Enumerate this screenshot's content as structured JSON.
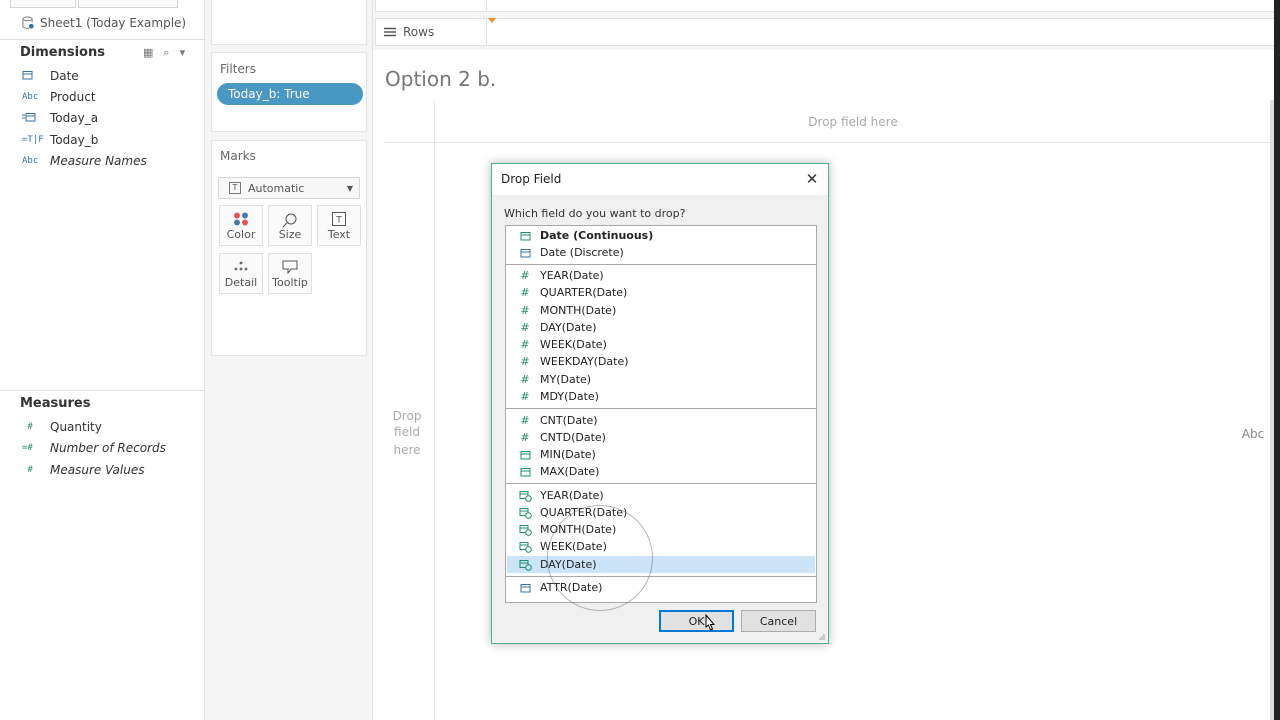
{
  "data_pane": {
    "datasource": "Sheet1 (Today Example)",
    "dimensions_header": "Dimensions",
    "dimensions": [
      {
        "icon": "calendar-icon",
        "type": "date",
        "label": "Date",
        "italic": false
      },
      {
        "icon": "abc-icon",
        "type": "string",
        "label": "Product",
        "italic": false
      },
      {
        "icon": "calculated-date-icon",
        "type": "calc-date",
        "label": "Today_a",
        "italic": false
      },
      {
        "icon": "boolean-icon",
        "type": "bool",
        "label": "Today_b",
        "italic": false
      },
      {
        "icon": "abc-icon",
        "type": "string",
        "label": "Measure Names",
        "italic": true
      }
    ],
    "measures_header": "Measures",
    "measures": [
      {
        "icon": "hash-icon",
        "label": "Quantity",
        "italic": false
      },
      {
        "icon": "calculated-hash-icon",
        "label": "Number of Records",
        "italic": true
      },
      {
        "icon": "hash-icon",
        "label": "Measure Values",
        "italic": true
      }
    ]
  },
  "cards": {
    "filters_title": "Filters",
    "filter_pill": "Today_b: True",
    "marks_title": "Marks",
    "marks_type": "Automatic",
    "mark_buttons": [
      "Color",
      "Size",
      "Text",
      "Detail",
      "Tooltip"
    ]
  },
  "shelves": {
    "rows_label": "Rows"
  },
  "view": {
    "title": "Option 2 b.",
    "drop_columns": "Drop field here",
    "drop_rows_1": "Drop",
    "drop_rows_2": "field",
    "drop_rows_3": "here",
    "abc": "Abc"
  },
  "dialog": {
    "title": "Drop Field",
    "question": "Which field do you want to drop?",
    "groups": [
      [
        {
          "label": "Date (Continuous)",
          "icon": "calendar-icon",
          "bold": true
        },
        {
          "label": "Date (Discrete)",
          "icon": "calendar-icon",
          "bold": false
        }
      ],
      [
        {
          "label": "YEAR(Date)",
          "icon": "hash-icon",
          "bold": false
        },
        {
          "label": "QUARTER(Date)",
          "icon": "hash-icon",
          "bold": false
        },
        {
          "label": "MONTH(Date)",
          "icon": "hash-icon",
          "bold": false
        },
        {
          "label": "DAY(Date)",
          "icon": "hash-icon",
          "bold": false
        },
        {
          "label": "WEEK(Date)",
          "icon": "hash-icon",
          "bold": false
        },
        {
          "label": "WEEKDAY(Date)",
          "icon": "hash-icon",
          "bold": false
        },
        {
          "label": "MY(Date)",
          "icon": "hash-icon",
          "bold": false
        },
        {
          "label": "MDY(Date)",
          "icon": "hash-icon",
          "bold": false
        }
      ],
      [
        {
          "label": "CNT(Date)",
          "icon": "hash-icon",
          "bold": false
        },
        {
          "label": "CNTD(Date)",
          "icon": "hash-icon",
          "bold": false
        },
        {
          "label": "MIN(Date)",
          "icon": "calendar-icon",
          "bold": false
        },
        {
          "label": "MAX(Date)",
          "icon": "calendar-icon",
          "bold": false
        }
      ],
      [
        {
          "label": "YEAR(Date)",
          "icon": "date-clock-icon",
          "bold": false
        },
        {
          "label": "QUARTER(Date)",
          "icon": "date-clock-icon",
          "bold": false
        },
        {
          "label": "MONTH(Date)",
          "icon": "date-clock-icon",
          "bold": false
        },
        {
          "label": "WEEK(Date)",
          "icon": "date-clock-icon",
          "bold": false
        },
        {
          "label": "DAY(Date)",
          "icon": "date-clock-icon",
          "bold": false,
          "selected": true
        }
      ],
      [
        {
          "label": "ATTR(Date)",
          "icon": "calendar-icon",
          "bold": false
        }
      ]
    ],
    "ok_label": "OK",
    "cancel_label": "Cancel"
  },
  "colors": {
    "accent_green": "#44b58c",
    "pill_blue": "#4997c3",
    "selection_blue": "#cce4f7"
  }
}
